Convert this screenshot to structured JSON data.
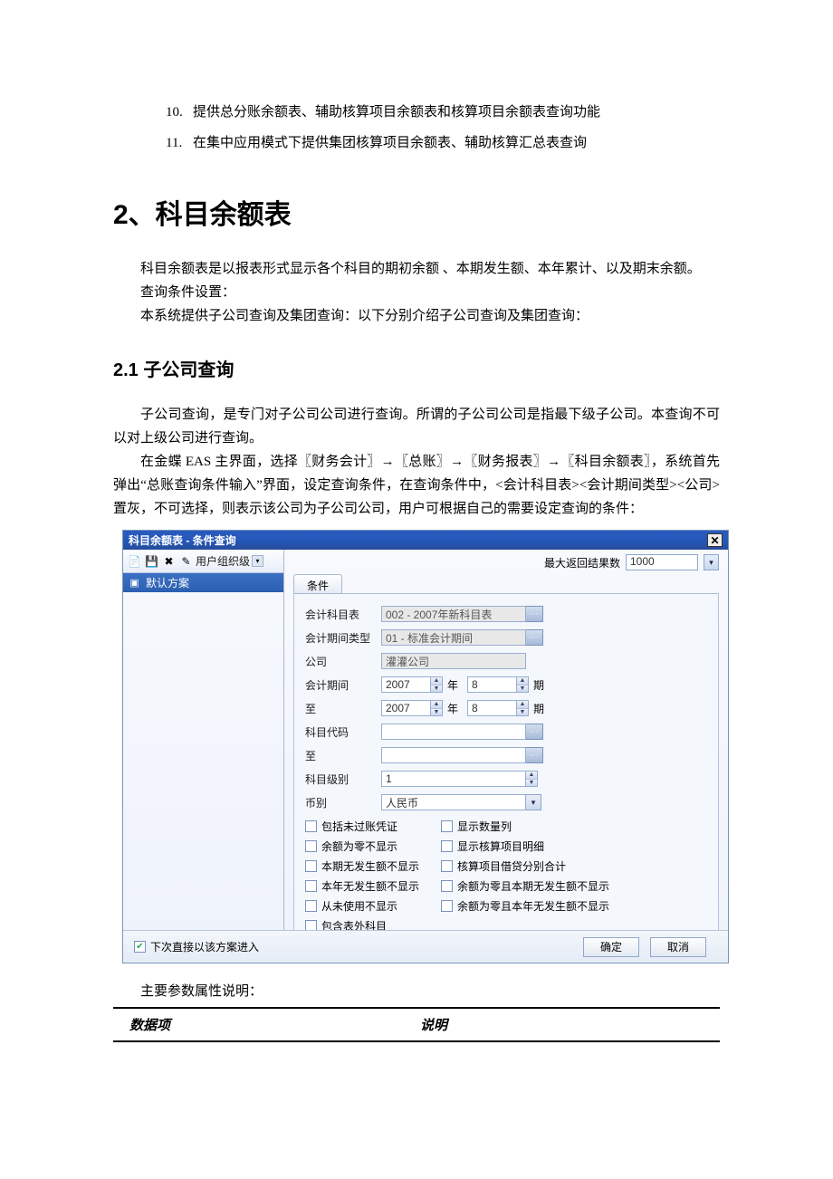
{
  "list": [
    {
      "num": "10.",
      "text": "提供总分账余额表、辅助核算项目余额表和核算项目余额表查询功能"
    },
    {
      "num": "11.",
      "text": "在集中应用模式下提供集团核算项目余额表、辅助核算汇总表查询"
    }
  ],
  "heading2": "2、科目余额表",
  "para1": "科目余额表是以报表形式显示各个科目的期初余额 、本期发生额、本年累计、以及期末余额。",
  "para2": "查询条件设置：",
  "para3": "本系统提供子公司查询及集团查询：以下分别介绍子公司查询及集团查询：",
  "sub21": "2.1 子公司查询",
  "para4": "子公司查询，是专门对子公司公司进行查询。所谓的子公司公司是指最下级子公司。本查询不可以对上级公司进行查询。",
  "para5": "在金蝶 EAS 主界面，选择〖财务会计〗→〖总账〗→〖财务报表〗→〖科目余额表〗，系统首先弹出“总账查询条件输入”界面，设定查询条件，在查询条件中，<会计科目表><会计期间类型><公司>置灰，不可选择，则表示该公司为子公司公司，用户可根据自己的需要设定查询的条件：",
  "dialog": {
    "title": "科目余额表 - 条件查询",
    "close": "✕",
    "toolbar_label": "用户组织级",
    "scheme": "默认方案",
    "max_results_label": "最大返回结果数",
    "max_results_value": "1000",
    "tab_label": "条件",
    "form": {
      "chart_of_accounts": {
        "label": "会计科目表",
        "value": "002 - 2007年新科目表"
      },
      "period_type": {
        "label": "会计期间类型",
        "value": "01 - 标准会计期间"
      },
      "company": {
        "label": "公司",
        "value": "灌灌公司"
      },
      "period_from": {
        "label": "会计期间",
        "year": "2007",
        "period": "8",
        "year_suffix": "年",
        "period_suffix": "期"
      },
      "period_to": {
        "label": "至",
        "year": "2007",
        "period": "8",
        "year_suffix": "年",
        "period_suffix": "期"
      },
      "account_code": {
        "label": "科目代码",
        "value": ""
      },
      "account_to": {
        "label": "至",
        "value": ""
      },
      "account_level": {
        "label": "科目级别",
        "value": "1"
      },
      "currency": {
        "label": "币别",
        "value": "人民币"
      }
    },
    "checks_left": [
      "包括未过账凭证",
      "余额为零不显示",
      "本期无发生额不显示",
      "本年无发生额不显示",
      "从未使用不显示",
      "包含表外科目"
    ],
    "checks_right": [
      "显示数量列",
      "显示核算项目明细",
      "核算项目借贷分别合计",
      "余额为零且本期无发生额不显示",
      "余额为零且本年无发生额不显示"
    ],
    "footer_check": "下次直接以该方案进入",
    "ok": "确定",
    "cancel": "取消"
  },
  "param_intro": "主要参数属性说明：",
  "param_headers": {
    "col1": "数据项",
    "col2": "说明"
  }
}
